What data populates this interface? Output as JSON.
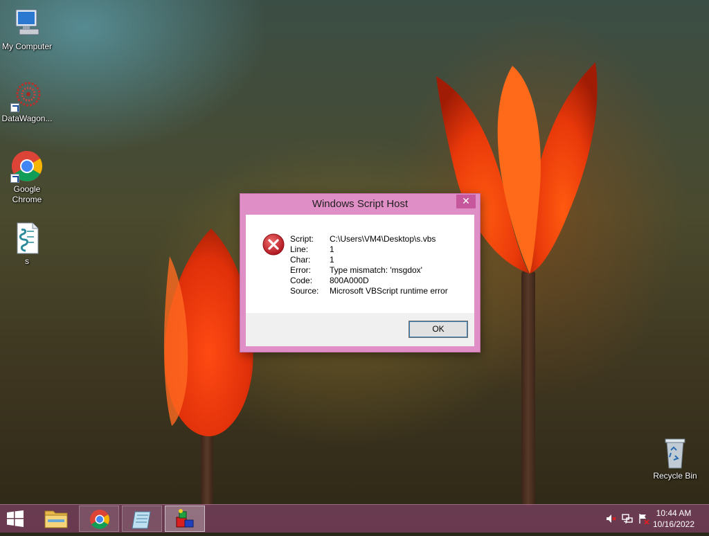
{
  "desktop": {
    "icons": [
      {
        "label": "My Computer"
      },
      {
        "label": "DataWagon..."
      },
      {
        "label": "Google Chrome"
      },
      {
        "label": "s"
      },
      {
        "label": "Recycle Bin"
      }
    ]
  },
  "dialog": {
    "title": "Windows Script Host",
    "close_glyph": "✕",
    "fields": [
      {
        "label": "Script:",
        "value": "C:\\Users\\VM4\\Desktop\\s.vbs"
      },
      {
        "label": "Line:",
        "value": "1"
      },
      {
        "label": "Char:",
        "value": "1"
      },
      {
        "label": "Error:",
        "value": "Type mismatch: 'msgdox'"
      },
      {
        "label": "Code:",
        "value": "800A000D"
      },
      {
        "label": "Source:",
        "value": "Microsoft VBScript runtime error"
      }
    ],
    "ok_label": "OK",
    "icon": "error-icon"
  },
  "taskbar": {
    "buttons": [
      {
        "icon": "file-explorer-icon"
      },
      {
        "icon": "chrome-icon"
      },
      {
        "icon": "notepad-icon"
      },
      {
        "icon": "script-host-icon"
      }
    ],
    "tray": {
      "icons": [
        "volume-muted-icon",
        "network-icon",
        "action-center-icon"
      ],
      "time": "10:44 AM",
      "date": "10/16/2022"
    }
  },
  "colors": {
    "dialog_frame": "#e08fc6",
    "taskbar": "#7a4060",
    "error_red": "#c8202a"
  }
}
